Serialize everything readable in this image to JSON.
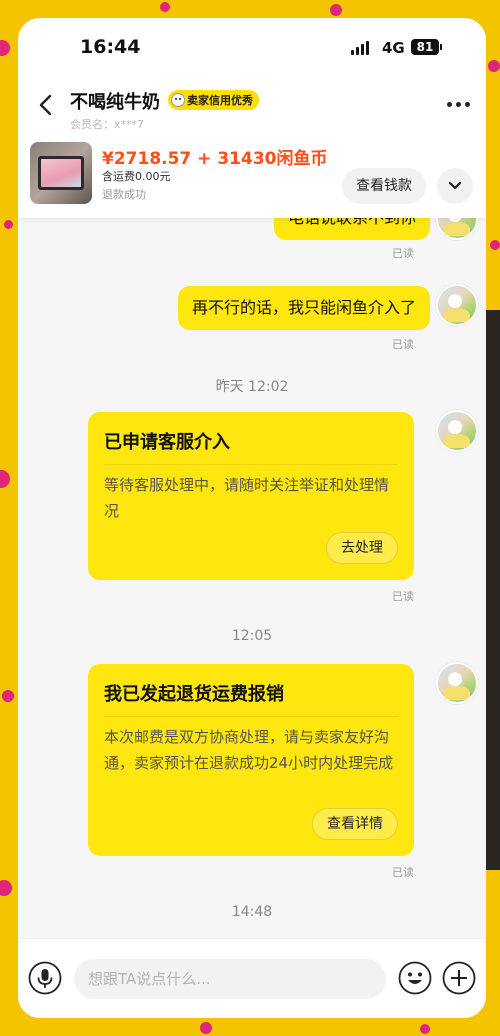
{
  "status_bar": {
    "time": "16:44",
    "network": "4G",
    "battery": "81"
  },
  "header": {
    "seller_name": "不喝纯牛奶",
    "credit_badge": "卖家信用优秀",
    "member_id": "会员名：x***7",
    "back_icon": "chevron-left-icon",
    "more_icon": "more-dots-icon"
  },
  "product": {
    "price": "¥2718.57 + 31430闲鱼币",
    "shipping": "含运费0.00元",
    "status": "退款成功",
    "wallet_button": "查看钱款",
    "expand_icon": "chevron-down-icon"
  },
  "messages": [
    {
      "type": "text",
      "text": "电话说联系不到你",
      "read": "已读"
    },
    {
      "type": "text",
      "text": "再不行的话，我只能闲鱼介入了",
      "read": "已读"
    },
    {
      "type": "time",
      "text": "昨天 12:02"
    },
    {
      "type": "card",
      "title": "已申请客服介入",
      "body": "等待客服处理中，请随时关注举证和处理情况",
      "button": "去处理",
      "read": "已读"
    },
    {
      "type": "time",
      "text": "12:05"
    },
    {
      "type": "card",
      "title": "我已发起退货运费报销",
      "body": "本次邮费是双方协商处理，请与卖家友好沟通，卖家预计在退款成功24小时内处理完成",
      "button": "查看详情",
      "read": "已读"
    },
    {
      "type": "time",
      "text": "14:48"
    }
  ],
  "input_bar": {
    "placeholder": "想跟TA说点什么...",
    "mic_icon": "microphone-icon",
    "emoji_icon": "emoji-icon",
    "plus_icon": "plus-icon"
  },
  "colors": {
    "bubble": "#ffe60f",
    "price": "#ff4e1a",
    "background": "#f5c400",
    "accent_dots": "#e0257a"
  }
}
